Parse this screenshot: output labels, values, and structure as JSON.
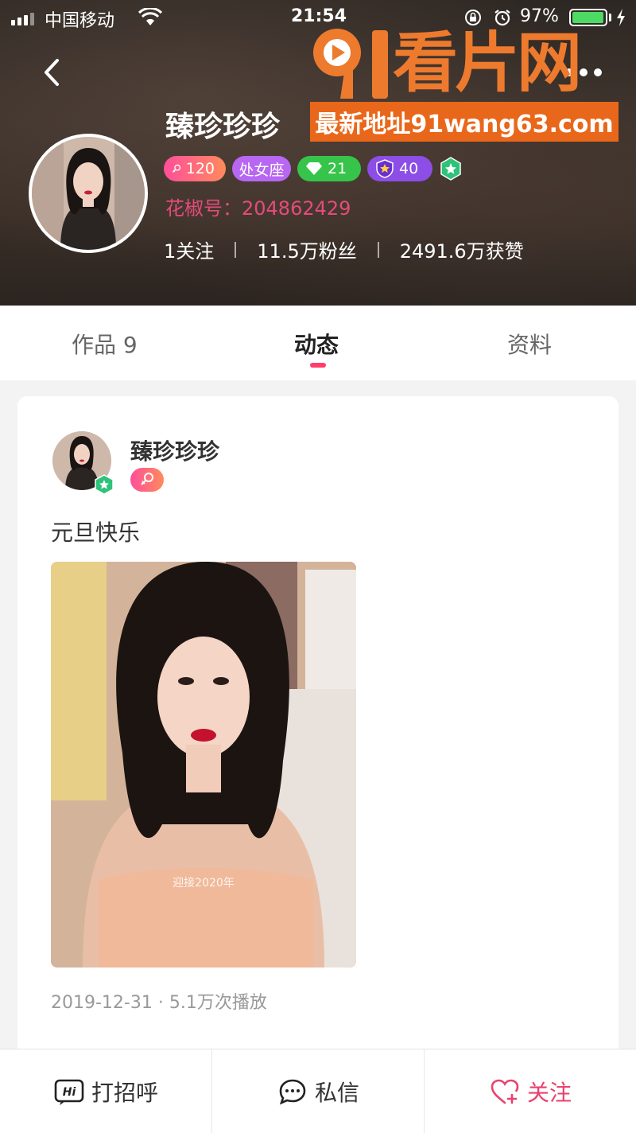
{
  "status_bar": {
    "carrier": "中国移动",
    "time": "21:54",
    "battery_percent": "97%",
    "battery_level": 0.97
  },
  "watermark": {
    "logo_text": "91看片网",
    "banner_text": "最新地址91wang63.com"
  },
  "profile": {
    "name": "臻珍珍珍",
    "badges": {
      "gender_level": "120",
      "zodiac": "处女座",
      "diamond_level": "21",
      "star_level": "40"
    },
    "huajiao_id": "花椒号：204862429",
    "stats": {
      "following": "1关注",
      "fans": "11.5万粉丝",
      "likes": "2491.6万获赞"
    }
  },
  "tabs": [
    {
      "label": "作品 9",
      "active": false
    },
    {
      "label": "动态",
      "active": true
    },
    {
      "label": "资料",
      "active": false
    }
  ],
  "post": {
    "author": "臻珍珍珍",
    "text": "元旦快乐",
    "image_caption": "迎接2020年",
    "meta": "2019-12-31 · 5.1万次播放"
  },
  "bottom_bar": {
    "greet": "打招呼",
    "message": "私信",
    "follow": "关注"
  },
  "colors": {
    "accent_pink": "#e8426f",
    "huajiao_pink": "#e44b7a",
    "watermark_orange": "#e9671a",
    "tab_indicator": "#ff3d6a"
  }
}
